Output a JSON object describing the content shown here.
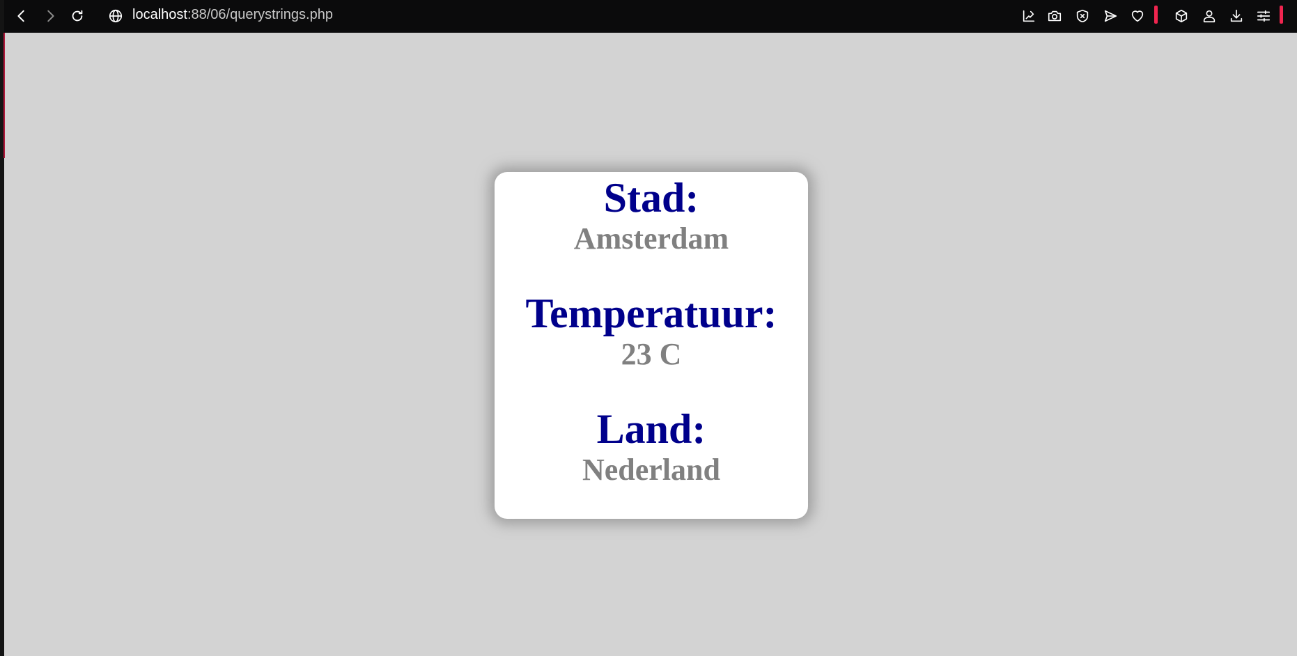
{
  "browser": {
    "url_host": "localhost",
    "url_path": ":88/06/querystrings.php",
    "icons": {
      "back": "chevron-left-icon",
      "forward": "chevron-right-icon",
      "reload": "reload-icon",
      "site_info": "globe-icon",
      "toolbar": [
        "edit-chart-icon",
        "camera-icon",
        "shield-x-icon",
        "send-icon",
        "heart-icon",
        "cube-icon",
        "profile-icon",
        "download-icon",
        "settings-sliders-icon"
      ]
    },
    "accent_color": "#f0254f"
  },
  "card": {
    "items": [
      {
        "label": "Stad:",
        "value": "Amsterdam"
      },
      {
        "label": "Temperatuur:",
        "value": "23 C"
      },
      {
        "label": "Land:",
        "value": "Nederland"
      }
    ],
    "label_color": "#00008b",
    "value_color": "#808080"
  }
}
